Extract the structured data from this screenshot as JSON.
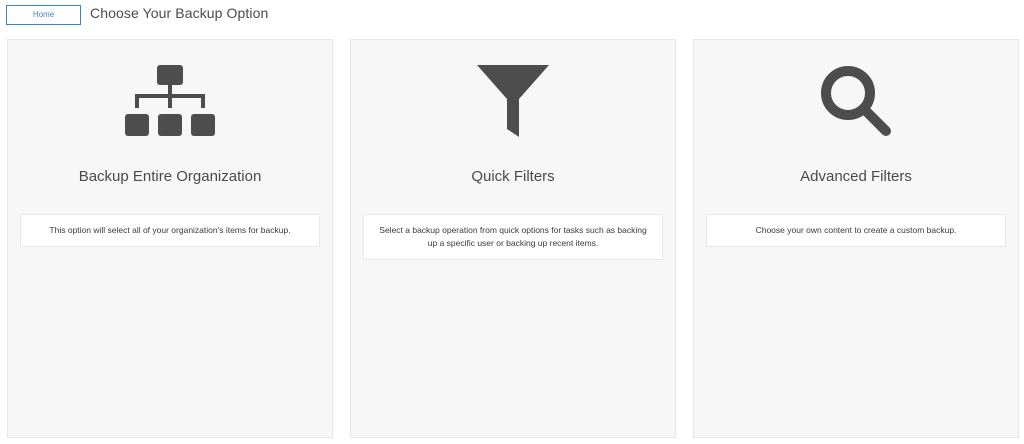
{
  "header": {
    "home_label": "Home",
    "title": "Choose Your Backup Option"
  },
  "cards": [
    {
      "icon": "org-chart-icon",
      "title": "Backup Entire Organization",
      "description": "This option will select all of your organization's items for backup."
    },
    {
      "icon": "filter-funnel-icon",
      "title": "Quick Filters",
      "description": "Select a backup operation from quick options for tasks such as backing up a specific user or backing up recent items."
    },
    {
      "icon": "search-magnifier-icon",
      "title": "Advanced Filters",
      "description": "Choose your own content to create a custom backup."
    }
  ],
  "colors": {
    "accent": "#3c82c8",
    "icon": "#4d4d4d",
    "card_bg": "#f7f7f7"
  }
}
